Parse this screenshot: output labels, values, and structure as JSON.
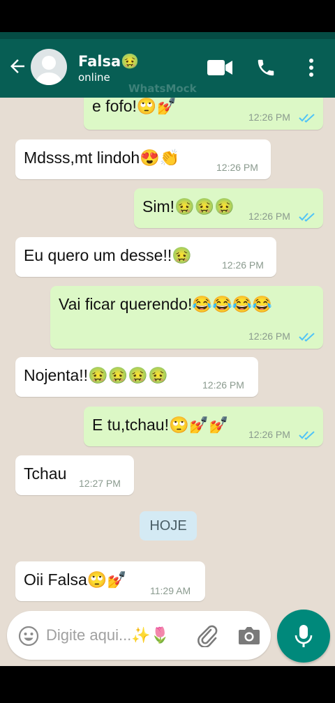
{
  "header": {
    "contact_name": "Falsa🤢",
    "status": "online",
    "watermark": "WhatsMock"
  },
  "messages": [
    {
      "direction": "out",
      "text": "e fofo!🙄💅",
      "time": "12:26 PM",
      "read": true
    },
    {
      "direction": "in",
      "text": "Mdsss,mt lindoh😍👏",
      "time": "12:26 PM"
    },
    {
      "direction": "out",
      "text": "Sim!🤢🤢🤢",
      "time": "12:26 PM",
      "read": true
    },
    {
      "direction": "in",
      "text": "Eu quero um desse!!🤢",
      "time": "12:26 PM"
    },
    {
      "direction": "out",
      "text": "Vai ficar querendo!😂😂😂😂",
      "time": "12:26 PM",
      "read": true
    },
    {
      "direction": "in",
      "text": "Nojenta!!🤢🤢🤢🤢",
      "time": "12:26 PM"
    },
    {
      "direction": "out",
      "text": "E tu,tchau!🙄💅💅",
      "time": "12:26 PM",
      "read": true
    },
    {
      "direction": "in",
      "text": "Tchau",
      "time": "12:27 PM"
    },
    {
      "direction": "in",
      "text": "Oii Falsa🙄💅",
      "time": "11:29 AM"
    }
  ],
  "date_divider": "HOJE",
  "composer": {
    "placeholder": "Digite aqui...✨🌷"
  },
  "colors": {
    "header": "#075e54",
    "outgoing_bubble": "#dcf8c6",
    "incoming_bubble": "#ffffff",
    "chat_background": "#e6ddd3",
    "read_ticks": "#4fc3f7",
    "mic_button": "#00897b"
  },
  "icons": [
    "back-arrow-icon",
    "video-call-icon",
    "phone-icon",
    "more-vert-icon",
    "emoji-icon",
    "attach-icon",
    "camera-icon",
    "mic-icon"
  ]
}
